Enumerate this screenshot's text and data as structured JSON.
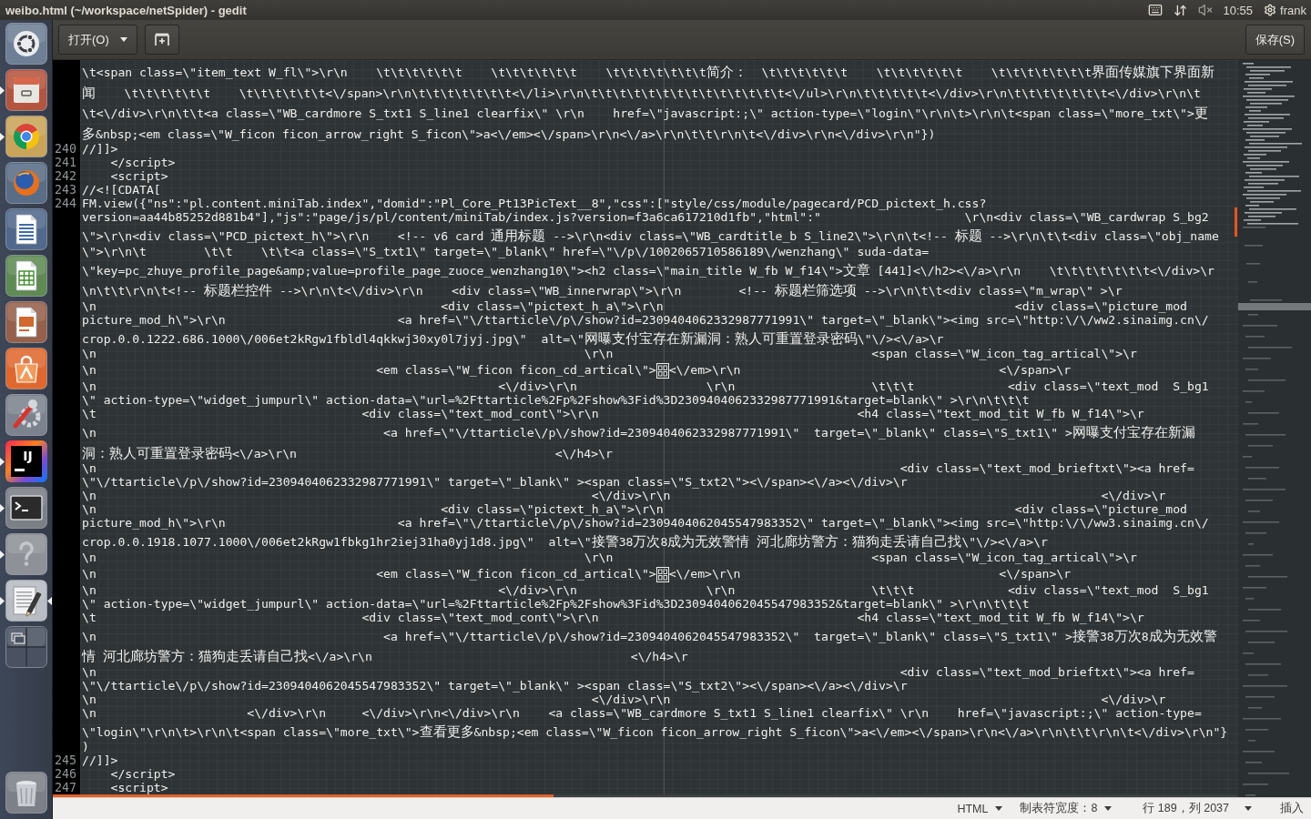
{
  "top_panel": {
    "title": "weibo.html (~/workspace/netSpider) - gedit",
    "clock": "10:55",
    "user": "frank"
  },
  "launcher": {
    "items": [
      {
        "kind": "dash",
        "running": false,
        "focused": false
      },
      {
        "kind": "drive",
        "running": true,
        "focused": false
      },
      {
        "kind": "chrome",
        "running": true,
        "focused": false
      },
      {
        "kind": "firefox",
        "running": false,
        "focused": false
      },
      {
        "kind": "writer",
        "running": false,
        "focused": false
      },
      {
        "kind": "calc",
        "running": false,
        "focused": false
      },
      {
        "kind": "impress",
        "running": false,
        "focused": false
      },
      {
        "kind": "store",
        "running": false,
        "focused": false
      },
      {
        "kind": "settings",
        "running": false,
        "focused": false
      },
      {
        "kind": "ide",
        "label": "IJ",
        "running": true,
        "focused": false
      },
      {
        "kind": "terminal",
        "running": true,
        "focused": false
      },
      {
        "kind": "help",
        "running": true,
        "focused": false
      },
      {
        "kind": "editor",
        "running": true,
        "focused": true
      },
      {
        "kind": "workspaces",
        "running": false,
        "focused": false
      },
      {
        "kind": "trash",
        "running": false,
        "focused": false
      }
    ]
  },
  "toolbar": {
    "open_button": "打开(O)",
    "save_button": "保存(S)"
  },
  "editor": {
    "lines": [
      {
        "rows": [
          {
            "kind": "plain",
            "text": "\\t<span class=\\\"item_text W_fl\\\">\\r\\n    \\t\\t\\t\\t\\t\\t    \\t\\t\\t\\t\\t\\t    \\t\\t\\t\\t\\t\\t\\t简介：  \\t\\t\\t\\t\\t\\t    \\t\\t\\t\\t\\t\\t    \\t\\t\\t\\t\\t\\t\\t界面传媒旗下界面新"
          },
          {
            "kind": "plain",
            "text": "闻    \\t\\t\\t\\t\\t\\t    \\t\\t\\t\\t\\t\\t<\\/span>\\r\\n\\t\\t\\t\\t\\t\\t\\t<\\/li>\\r\\n\\t\\t\\t\\t\\t\\t\\t\\t\\t\\t\\t\\t\\t\\t<\\/ul>\\r\\n\\t\\t\\t\\t\\t<\\/div>\\r\\n\\t\\t\\t\\t\\t\\t\\t<\\/div>\\r\\n\\t"
          },
          {
            "kind": "plain",
            "text": "\\t<\\/div>\\r\\n\\t\\t<a class=\\\"WB_cardmore S_txt1 S_line1 clearfix\\\" \\r\\n    href=\\\"javascript:;\\\" action-type=\\\"login\\\"\\r\\n\\t>\\r\\n\\t<span class=\\\"more_txt\\\">更"
          },
          {
            "kind": "plain",
            "text": "多&nbsp;<em class=\\\"W_ficon ficon_arrow_right S_ficon\\\">a<\\/em><\\/span>\\r\\n<\\/a>\\r\\n\\t\\t\\r\\n\\t<\\/div>\\r\\n<\\/div>\\r\\n\"})"
          }
        ]
      },
      {
        "number": "240",
        "rows": [
          {
            "kind": "plain",
            "text": "//]]>"
          }
        ]
      },
      {
        "number": "241",
        "rows": [
          {
            "kind": "plain",
            "text": "    </script>"
          }
        ]
      },
      {
        "number": "242",
        "rows": [
          {
            "kind": "plain",
            "text": "    <script>"
          }
        ]
      },
      {
        "number": "243",
        "rows": [
          {
            "kind": "plain",
            "text": "//<![CDATA["
          }
        ]
      },
      {
        "number": "244",
        "rows": [
          {
            "kind": "plain",
            "text": "FM.view({\"ns\":\"pl.content.miniTab.index\",\"domid\":\"Pl_Core_Pt13PicText__8\",\"css\":[\"style/css/module/pagecard/PCD_pictext_h.css?"
          },
          {
            "kind": "plain",
            "text": "version=aa44b85252d881b4\"],\"js\":\"page/js/pl/content/miniTab/index.js?version=f3a6ca617210d1fb\",\"html\":\"                    \\r\\n<div class=\\\"WB_cardwrap S_bg2"
          },
          {
            "kind": "plain",
            "text": "\\\">\\r\\n<div class=\\\"PCD_pictext_h\\\">\\r\\n    <!-- v6 card 通用标题 -->\\r\\n<div class=\\\"WB_cardtitle_b S_line2\\\">\\r\\n\\t<!-- 标题 -->\\r\\n\\t\\t<div class=\\\"obj_name"
          },
          {
            "kind": "plain",
            "text": "\\\">\\r\\n\\t        \\t\\t    \\t\\t<a class=\\\"S_txt1\\\" target=\\\"_blank\\\" href=\\\"\\/p\\/1002065710586189\\/wenzhang\\\" suda-data="
          },
          {
            "kind": "plain",
            "text": "\\\"key=pc_zhuye_profile_page&amp;value=profile_page_zuoce_wenzhang10\\\"><h2 class=\\\"main_title W_fb W_f14\\\">文章 [441]<\\/h2><\\/a>\\r\\n    \\t\\t\\t\\t\\t\\t\\t<\\/div>\\r"
          },
          {
            "kind": "plain",
            "text": "\\n\\t\\t\\r\\n\\t<!-- 标题栏控件 -->\\r\\n\\t<\\/div>\\r\\n    <div class=\\\"WB_innerwrap\\\">\\r\\n        <!-- 标题栏筛选项 -->\\r\\n\\t\\t<div class=\\\"m_wrap\\\" >\\r"
          },
          {
            "kind": "plain",
            "text": "\\n                                                <div class=\\\"pictext_h_a\\\">\\r\\n                                                 <div class=\\\"picture_mod"
          },
          {
            "kind": "plain",
            "text": "picture_mod_h\\\">\\r\\n                        <a href=\\\"\\/ttarticle\\/p\\/show?id=2309404062332987771991\\\" target=\\\"_blank\\\"><img src=\\\"http:\\/\\/ww2.sinaimg.cn\\/"
          },
          {
            "kind": "plain",
            "text": "crop.0.0.1222.686.1000\\/006et2kRgw1fbldl4qkkwj30xy0l7jyj.jpg\\\"  alt=\\\"网曝支付宝存在新漏洞：熟人可重置登录密码\\\"\\/><\\/a>\\r"
          },
          {
            "kind": "plain",
            "text": "\\n                                                                    \\r\\n                                    <span class=\\\"W_icon_tag_artical\\\">\\r"
          },
          {
            "kind": "glyph",
            "before": "\\n                                       <em class=\\\"W_ficon ficon_cd_artical\\\">",
            "after": "<\\/em>\\r\\n                                    <\\/span>\\r"
          },
          {
            "kind": "plain",
            "text": "\\n                                                        <\\/div>\\r\\n                  \\r\\n                   \\t\\t\\t             <div class=\\\"text_mod  S_bg1"
          },
          {
            "kind": "plain",
            "text": "\\\" action-type=\\\"widget_jumpurl\\\" action-data=\\\"url=%2Fttarticle%2Fp%2Fshow%3Fid%3D2309404062332987771991&target=blank\\\" >\\r\\n\\t\\t\\t"
          },
          {
            "kind": "plain",
            "text": "\\t                                     <div class=\\\"text_mod_cont\\\">\\r\\n                                    <h4 class=\\\"text_mod_tit W_fb W_f14\\\">\\r"
          },
          {
            "kind": "plain",
            "text": "\\n                                        <a href=\\\"\\/ttarticle\\/p\\/show?id=2309404062332987771991\\\"  target=\\\"_blank\\\" class=\\\"S_txt1\\\" >网曝支付宝存在新漏"
          },
          {
            "kind": "plain",
            "text": "洞：熟人可重置登录密码<\\/a>\\r\\n                                    <\\/h4>\\r"
          },
          {
            "kind": "plain",
            "text": "\\n                                                                                                                <div class=\\\"text_mod_brieftxt\\\"><a href="
          },
          {
            "kind": "plain",
            "text": "\\\"\\/ttarticle\\/p\\/show?id=2309404062332987771991\\\" target=\\\"_blank\\\" ><span class=\\\"S_txt2\\\"><\\/span><\\/a><\\/div>\\r"
          },
          {
            "kind": "plain",
            "text": "\\n                                                                     <\\/div>\\r\\n                                                            <\\/div>\\r"
          },
          {
            "kind": "plain",
            "text": "\\n                                                <div class=\\\"pictext_h_a\\\">\\r\\n                                                 <div class=\\\"picture_mod"
          },
          {
            "kind": "plain",
            "text": "picture_mod_h\\\">\\r\\n                        <a href=\\\"\\/ttarticle\\/p\\/show?id=2309404062045547983352\\\" target=\\\"_blank\\\"><img src=\\\"http:\\/\\/ww3.sinaimg.cn\\/"
          },
          {
            "kind": "plain",
            "text": "crop.0.0.1918.1077.1000\\/006et2kRgw1fbkg1hr2iej31ha0yj1d8.jpg\\\"  alt=\\\"接警38万次8成为无效警情 河北廊坊警方：猫狗走丢请自己找\\\"\\/><\\/a>\\r"
          },
          {
            "kind": "plain",
            "text": "\\n                                                                    \\r\\n                                    <span class=\\\"W_icon_tag_artical\\\">\\r"
          },
          {
            "kind": "glyph",
            "before": "\\n                                       <em class=\\\"W_ficon ficon_cd_artical\\\">",
            "after": "<\\/em>\\r\\n                                    <\\/span>\\r"
          },
          {
            "kind": "plain",
            "text": "\\n                                                        <\\/div>\\r\\n                  \\r\\n                   \\t\\t\\t             <div class=\\\"text_mod  S_bg1"
          },
          {
            "kind": "plain",
            "text": "\\\" action-type=\\\"widget_jumpurl\\\" action-data=\\\"url=%2Fttarticle%2Fp%2Fshow%3Fid%3D2309404062045547983352&target=blank\\\" >\\r\\n\\t\\t\\t"
          },
          {
            "kind": "plain",
            "text": "\\t                                     <div class=\\\"text_mod_cont\\\">\\r\\n                                    <h4 class=\\\"text_mod_tit W_fb W_f14\\\">\\r"
          },
          {
            "kind": "plain",
            "text": "\\n                                        <a href=\\\"\\/ttarticle\\/p\\/show?id=2309404062045547983352\\\"  target=\\\"_blank\\\" class=\\\"S_txt1\\\" >接警38万次8成为无效警"
          },
          {
            "kind": "plain",
            "text": "情 河北廊坊警方：猫狗走丢请自己找<\\/a>\\r\\n                                    <\\/h4>\\r"
          },
          {
            "kind": "plain",
            "text": "\\n                                                                                                                <div class=\\\"text_mod_brieftxt\\\"><a href="
          },
          {
            "kind": "plain",
            "text": "\\\"\\/ttarticle\\/p\\/show?id=2309404062045547983352\\\" target=\\\"_blank\\\" ><span class=\\\"S_txt2\\\"><\\/span><\\/a><\\/div>\\r"
          },
          {
            "kind": "plain",
            "text": "\\n                                                                     <\\/div>\\r\\n                                                            <\\/div>\\r"
          },
          {
            "kind": "plain",
            "text": "\\n                     <\\/div>\\r\\n     <\\/div>\\r\\n<\\/div>\\r\\n    <a class=\\\"WB_cardmore S_txt1 S_line1 clearfix\\\" \\r\\n    href=\\\"javascript:;\\\" action-type="
          },
          {
            "kind": "plain",
            "text": "\\\"login\\\"\\r\\n\\t>\\r\\n\\t<span class=\\\"more_txt\\\">查看更多&nbsp;<em class=\\\"W_ficon ficon_arrow_right S_ficon\\\">a<\\/em><\\/span>\\r\\n<\\/a>\\r\\n\\t\\t\\r\\n\\t<\\/div>\\r\\n\"}"
          },
          {
            "kind": "plain",
            "text": ")"
          }
        ]
      },
      {
        "number": "245",
        "rows": [
          {
            "kind": "plain",
            "text": "//]]>"
          }
        ]
      },
      {
        "number": "246",
        "rows": [
          {
            "kind": "plain",
            "text": "    </script>"
          }
        ]
      },
      {
        "number": "247",
        "rows": [
          {
            "kind": "plain",
            "text": "    <script>"
          }
        ]
      }
    ]
  },
  "status_bar": {
    "items": [
      {
        "kind": "dropdown",
        "label": "HTML"
      },
      {
        "kind": "dropdown",
        "label": "制表符宽度：8"
      },
      {
        "kind": "text",
        "label": "行 189，列 2037"
      },
      {
        "kind": "caret"
      },
      {
        "kind": "text",
        "label": "插入"
      }
    ]
  }
}
